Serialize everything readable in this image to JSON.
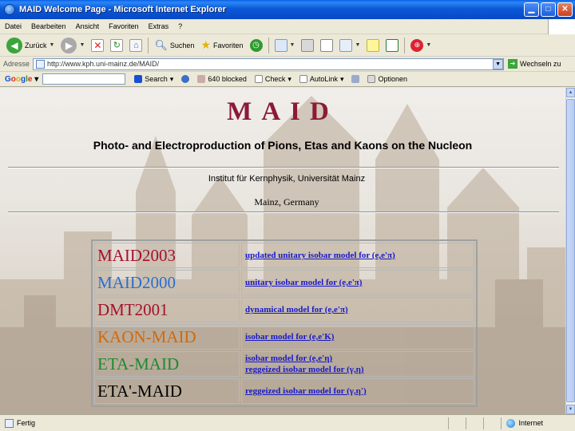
{
  "window": {
    "title": "MAID Welcome Page - Microsoft Internet Explorer"
  },
  "menu": [
    "Datei",
    "Bearbeiten",
    "Ansicht",
    "Favoriten",
    "Extras",
    "?"
  ],
  "toolbar": {
    "back": "Zurück",
    "search": "Suchen",
    "favorites": "Favoriten"
  },
  "address": {
    "label": "Adresse",
    "url": "http://www.kph.uni-mainz.de/MAID/",
    "go": "Wechseln zu"
  },
  "google": {
    "check": "Check",
    "autolink": "AutoLink",
    "options": "Optionen",
    "search": "Search",
    "blocked": "640 blocked"
  },
  "page": {
    "title": "MAID",
    "subtitle": "Photo- and Electroproduction of Pions, Etas and Kaons on the Nucleon",
    "institute": "Institut für Kernphysik, Universität Mainz",
    "location": "Mainz, Germany"
  },
  "models": [
    {
      "name": "MAID2003",
      "color": "#a5102e",
      "links": [
        "updated unitary isobar model for (e,e'π)"
      ]
    },
    {
      "name": "MAID2000",
      "color": "#2a6fcf",
      "links": [
        "unitary isobar model for (e,e'π)"
      ]
    },
    {
      "name": "DMT2001",
      "color": "#a5102e",
      "links": [
        "dynamical model for (e,e'π)"
      ]
    },
    {
      "name": "KAON-MAID",
      "color": "#d2690a",
      "links": [
        "isobar model for (e,e'K)"
      ]
    },
    {
      "name": "ETA-MAID",
      "color": "#1e8a2e",
      "links": [
        "isobar model for (e,e'η)",
        "reggeized isobar model for (γ,η)"
      ]
    },
    {
      "name": "ETA'-MAID",
      "color": "#000000",
      "links": [
        "reggeized isobar model for (γ,η')"
      ]
    }
  ],
  "status": {
    "text": "Fertig",
    "zone": "Internet"
  },
  "colors": {
    "titlebar": "#0548c6",
    "chrome": "#ece9d8",
    "link": "#1818c8",
    "title": "#8b1a36"
  }
}
